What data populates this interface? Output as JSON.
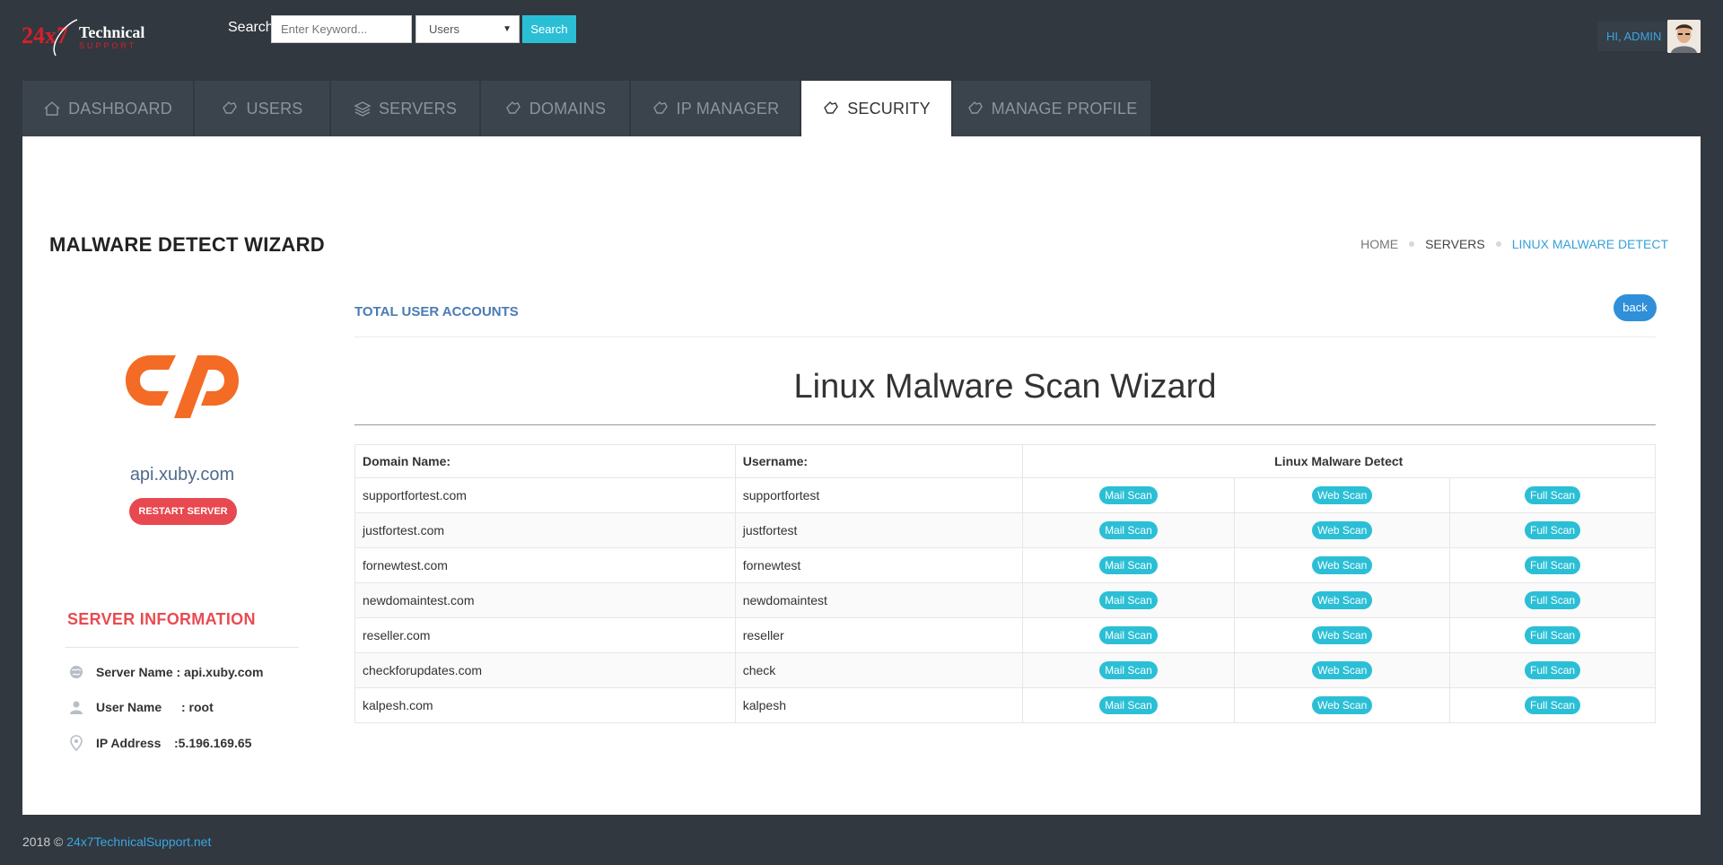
{
  "header": {
    "logo_text": "24x7 Technical Support",
    "search_label": "Search",
    "search_placeholder": "Enter Keyword...",
    "search_select_value": "Users",
    "search_button": "Search",
    "greeting": "HI, ADMIN"
  },
  "tabs": [
    {
      "label": "Dashboard",
      "icon": "home-icon",
      "active": false
    },
    {
      "label": "Users",
      "icon": "hand-icon",
      "active": false
    },
    {
      "label": "Servers",
      "icon": "layers-icon",
      "active": false
    },
    {
      "label": "Domains",
      "icon": "hand-icon",
      "active": false
    },
    {
      "label": "IP Manager",
      "icon": "hand-icon",
      "active": false
    },
    {
      "label": "Security",
      "icon": "hand-icon",
      "active": true
    },
    {
      "label": "Manage Profile",
      "icon": "hand-icon",
      "active": false
    }
  ],
  "page": {
    "title": "Malware Detect Wizard",
    "breadcrumb": {
      "home": "Home",
      "servers": "Servers",
      "current": "Linux Malware Detect"
    }
  },
  "left": {
    "server_name": "api.xuby.com",
    "restart_label": "Restart Server",
    "info_title": "Server Information",
    "rows": [
      {
        "icon": "globe-icon",
        "label": "Server Name : api.xuby.com"
      },
      {
        "icon": "user-icon",
        "label": "User Name",
        "value": ": root"
      },
      {
        "icon": "map-pin-icon",
        "label": "IP Address",
        "value": ":5.196.169.65"
      }
    ]
  },
  "right": {
    "total_accounts": "Total User Accounts",
    "back_label": "back",
    "wizard_title": "Linux Malware Scan Wizard",
    "table": {
      "headers": [
        "Domain Name:",
        "Username:",
        "Linux Malware Detect"
      ],
      "mail_label": "Mail Scan",
      "web_label": "Web Scan",
      "full_label": "Full Scan",
      "rows": [
        {
          "domain": "supportfortest.com",
          "username": "supportfortest"
        },
        {
          "domain": "justfortest.com",
          "username": "justfortest"
        },
        {
          "domain": "fornewtest.com",
          "username": "fornewtest"
        },
        {
          "domain": "newdomaintest.com",
          "username": "newdomaintest"
        },
        {
          "domain": "reseller.com",
          "username": "reseller"
        },
        {
          "domain": "checkforupdates.com",
          "username": "check"
        },
        {
          "domain": "kalpesh.com",
          "username": "kalpesh"
        }
      ]
    }
  },
  "footer": {
    "copyright": "2018 ©",
    "link": "24x7TechnicalSupport.net"
  },
  "colors": {
    "accent": "#2bbfd6",
    "danger": "#e8484f",
    "primary": "#2f8fd8",
    "bg_dark": "#313840"
  }
}
